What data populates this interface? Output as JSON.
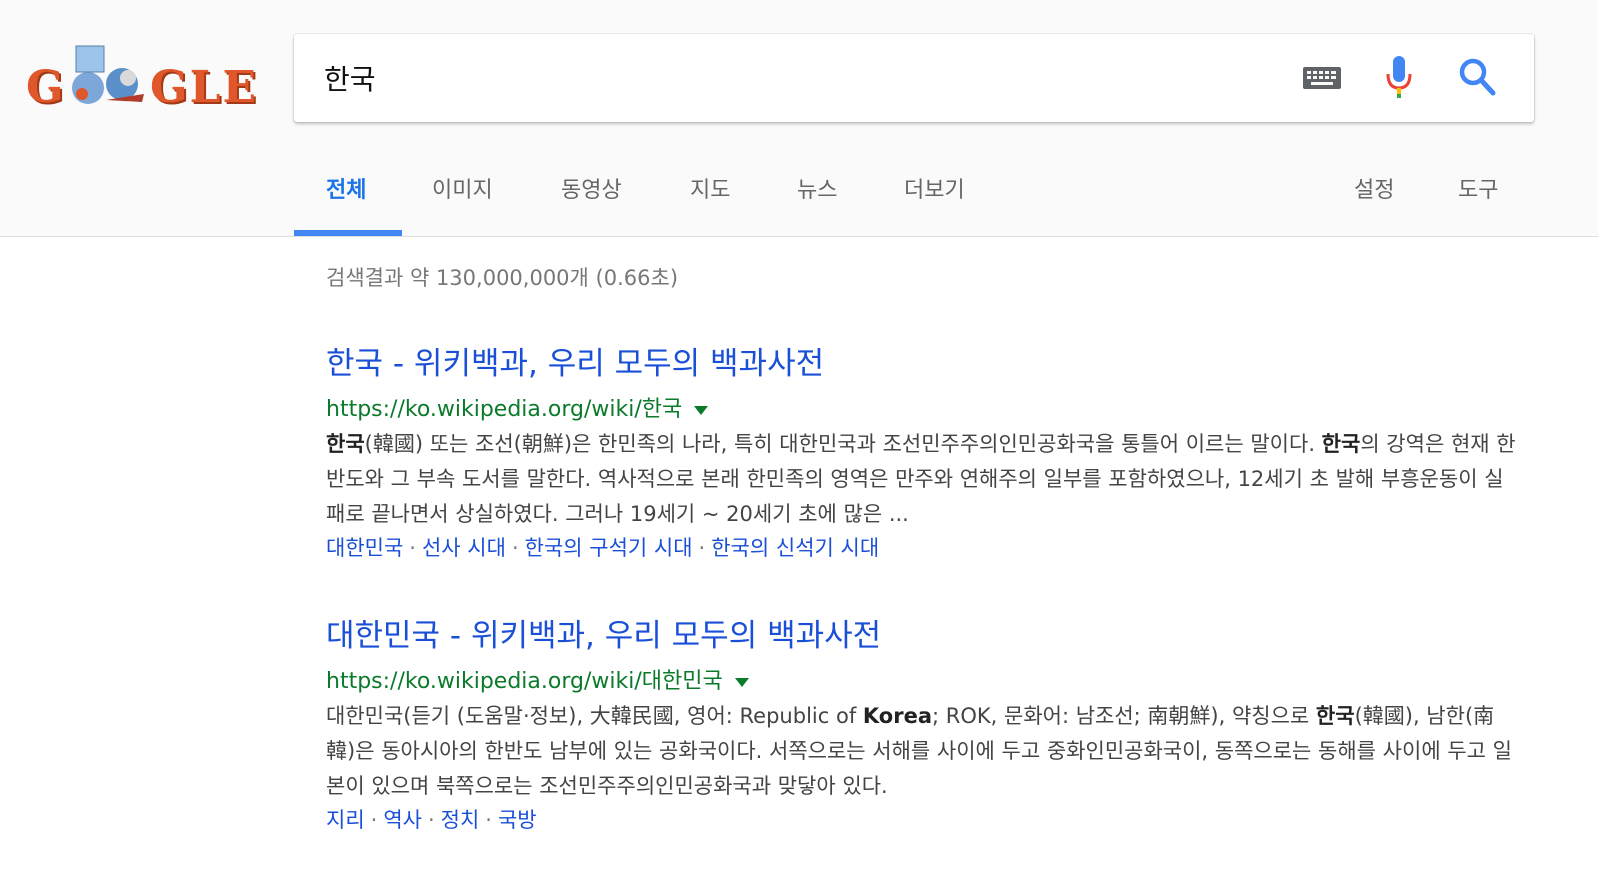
{
  "search": {
    "query": "한국"
  },
  "tabs": [
    {
      "label": "전체",
      "active": true
    },
    {
      "label": "이미지"
    },
    {
      "label": "동영상"
    },
    {
      "label": "지도"
    },
    {
      "label": "뉴스"
    },
    {
      "label": "더보기"
    }
  ],
  "tools": {
    "settings": "설정",
    "tools": "도구"
  },
  "stats": "검색결과 약 130,000,000개 (0.66초)",
  "results": [
    {
      "title": "한국 - 위키백과, 우리 모두의 백과사전",
      "url": "https://ko.wikipedia.org/wiki/한국",
      "snippet": [
        {
          "b": "한국"
        },
        {
          "t": "(韓國) 또는 조선(朝鮮)은 한민족의 나라, 특히 대한민국과 조선민주주의인민공화국을 통틀어 이르는 말이다. "
        },
        {
          "b": "한국"
        },
        {
          "t": "의 강역은 현재 한반도와 그 부속 도서를 말한다. 역사적으로 본래 한민족의 영역은 만주와 연해주의 일부를 포함하였으나, 12세기 초 발해 부흥운동이 실패로 끝나면서 상실하였다. 그러나 19세기 ~ 20세기 초에 많은 ..."
        }
      ],
      "sitelinks": [
        "대한민국",
        "선사 시대",
        "한국의 구석기 시대",
        "한국의 신석기 시대"
      ]
    },
    {
      "title": "대한민국 - 위키백과, 우리 모두의 백과사전",
      "url": "https://ko.wikipedia.org/wiki/대한민국",
      "snippet": [
        {
          "t": "대한민국(듣기 (도움말·정보), 大韓民國, 영어: Republic of "
        },
        {
          "b": "Korea"
        },
        {
          "t": "; ROK, 문화어: 남조선; 南朝鮮), 약칭으로 "
        },
        {
          "b": "한국"
        },
        {
          "t": "(韓國), 남한(南韓)은 동아시아의 한반도 남부에 있는 공화국이다. 서쪽으로는 서해를 사이에 두고 중화인민공화국이, 동쪽으로는 동해를 사이에 두고 일본이 있으며 북쪽으로는 조선민주주의인민공화국과 맞닿아 있다."
        }
      ],
      "sitelinks": [
        "지리",
        "역사",
        "정치",
        "국방"
      ]
    }
  ]
}
